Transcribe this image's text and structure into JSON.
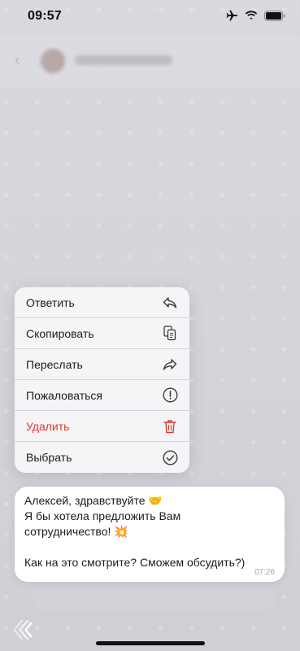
{
  "status_bar": {
    "time": "09:57",
    "icons": [
      "airplane-icon",
      "wifi-icon",
      "battery-icon"
    ]
  },
  "context_menu": {
    "items": [
      {
        "label": "Ответить",
        "icon": "reply-icon"
      },
      {
        "label": "Скопировать",
        "icon": "copy-icon"
      },
      {
        "label": "Переслать",
        "icon": "forward-icon"
      },
      {
        "label": "Пожаловаться",
        "icon": "report-icon"
      },
      {
        "label": "Удалить",
        "icon": "trash-icon",
        "color": "#e5352f"
      },
      {
        "label": "Выбрать",
        "icon": "select-check-icon"
      }
    ]
  },
  "message": {
    "lines": [
      "Алексей, здравствуйте 🤝",
      "Я бы хотела предложить Вам",
      "сотрудничество! 💥",
      "",
      "Как на это смотрите? Сможем обсудить?)"
    ],
    "time": "07:26"
  },
  "colors": {
    "danger": "#e5352f",
    "text": "#1c1c1e",
    "background": "#d4d4d9"
  }
}
